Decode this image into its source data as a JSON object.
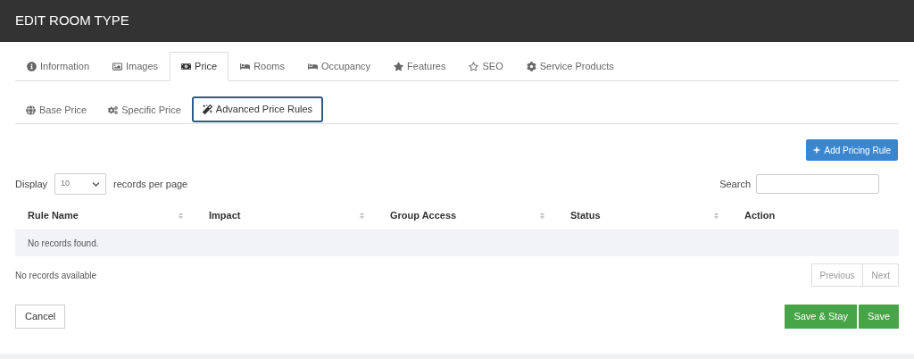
{
  "header": {
    "title": "EDIT ROOM TYPE"
  },
  "tabs": [
    {
      "label": "Information",
      "selected": false
    },
    {
      "label": "Images",
      "selected": false
    },
    {
      "label": "Price",
      "selected": true
    },
    {
      "label": "Rooms",
      "selected": false
    },
    {
      "label": "Occupancy",
      "selected": false
    },
    {
      "label": "Features",
      "selected": false
    },
    {
      "label": "SEO",
      "selected": false
    },
    {
      "label": "Service Products",
      "selected": false
    }
  ],
  "subtabs": [
    {
      "label": "Base Price",
      "selected": false
    },
    {
      "label": "Specific Price",
      "selected": false
    },
    {
      "label": "Advanced Price Rules",
      "selected": true
    }
  ],
  "add_button": "Add Pricing Rule",
  "display": {
    "label": "Display",
    "value": "10",
    "suffix": "records per page"
  },
  "search": {
    "label": "Search"
  },
  "table": {
    "columns": [
      "Rule Name",
      "Impact",
      "Group Access",
      "Status",
      "Action"
    ],
    "empty": "No records found."
  },
  "info": "No records available",
  "pagination": {
    "previous": "Previous",
    "next": "Next"
  },
  "buttons": {
    "cancel": "Cancel",
    "save_stay": "Save & Stay",
    "save": "Save"
  }
}
